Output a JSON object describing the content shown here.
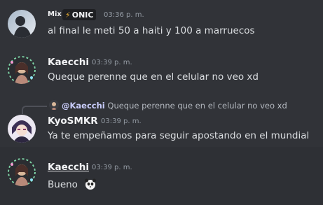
{
  "messages": [
    {
      "author": "Mix",
      "tag_icon": "lightning-icon",
      "tag_text": "ONIC",
      "time": "03:36 p. m.",
      "text": "al final le meti 50 a haiti y 100 a marruecos"
    },
    {
      "author": "Kaecchi",
      "time": "03:39 p. m.",
      "text": "Queque perenne que en el celular no veo xd"
    },
    {
      "reply_author": "@Kaecchi",
      "reply_text": "Queque perenne que en el celular no veo xd",
      "author": "KyoSMKR",
      "time": "03:39 p. m.",
      "text": "Ya te empeñamos para seguir apostando en el mundial"
    },
    {
      "author": "Kaecchi",
      "time": "03:39 p. m.",
      "text": "Bueno",
      "emoji": "panda-sticker-icon"
    }
  ],
  "colors": {
    "background": "#313338",
    "hover_row": "#2e3035",
    "reply_mention": "#c9cdfb",
    "tag_bolt": "#f0b232"
  }
}
